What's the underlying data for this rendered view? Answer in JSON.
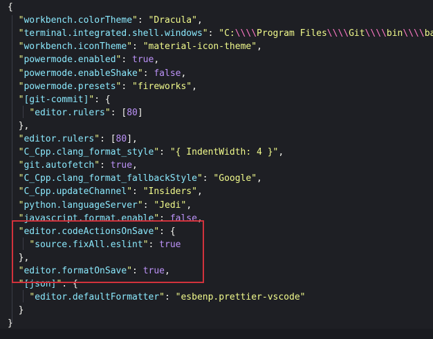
{
  "lines": [
    {
      "text": "{"
    },
    {
      "text": "  \"workbench.colorTheme\": \"Dracula\","
    },
    {
      "text": "  \"terminal.integrated.shell.windows\": \"C:\\\\\\\\Program Files\\\\\\\\Git\\\\\\\\bin\\\\\\\\bash.exe\","
    },
    {
      "text": "  \"workbench.iconTheme\": \"material-icon-theme\","
    },
    {
      "text": "  \"powermode.enabled\": true,"
    },
    {
      "text": "  \"powermode.enableShake\": false,"
    },
    {
      "text": "  \"powermode.presets\": \"fireworks\","
    },
    {
      "text": "  \"[git-commit]\": {"
    },
    {
      "text": "    \"editor.rulers\": [80]"
    },
    {
      "text": "  },"
    },
    {
      "text": "  \"editor.rulers\": [80],"
    },
    {
      "text": "  \"C_Cpp.clang_format_style\": \"{ IndentWidth: 4 }\","
    },
    {
      "text": "  \"git.autofetch\": true,"
    },
    {
      "text": "  \"C_Cpp.clang_format_fallbackStyle\": \"Google\","
    },
    {
      "text": "  \"C_Cpp.updateChannel\": \"Insiders\","
    },
    {
      "text": "  \"python.languageServer\": \"Jedi\","
    },
    {
      "text": "  \"javascript.format.enable\": false,"
    },
    {
      "text": "  \"editor.codeActionsOnSave\": {"
    },
    {
      "text": "    \"source.fixAll.eslint\": true"
    },
    {
      "text": "  },"
    },
    {
      "text": "  \"editor.formatOnSave\": true,"
    },
    {
      "text": "  \"[json]\": {"
    },
    {
      "text": "    \"editor.defaultFormatter\": \"esbenp.prettier-vscode\""
    },
    {
      "text": "  }"
    },
    {
      "text": "}"
    }
  ],
  "colors": {
    "background": "#1e1f24",
    "key": "#8be9fd",
    "string": "#f1fa8c",
    "constant": "#bd93f9",
    "punctuation": "#f8f8f2",
    "escape": "#ff79c6",
    "highlight_box": "#d2323c"
  },
  "highlight": {
    "from_line": 17,
    "to_line": 20
  }
}
